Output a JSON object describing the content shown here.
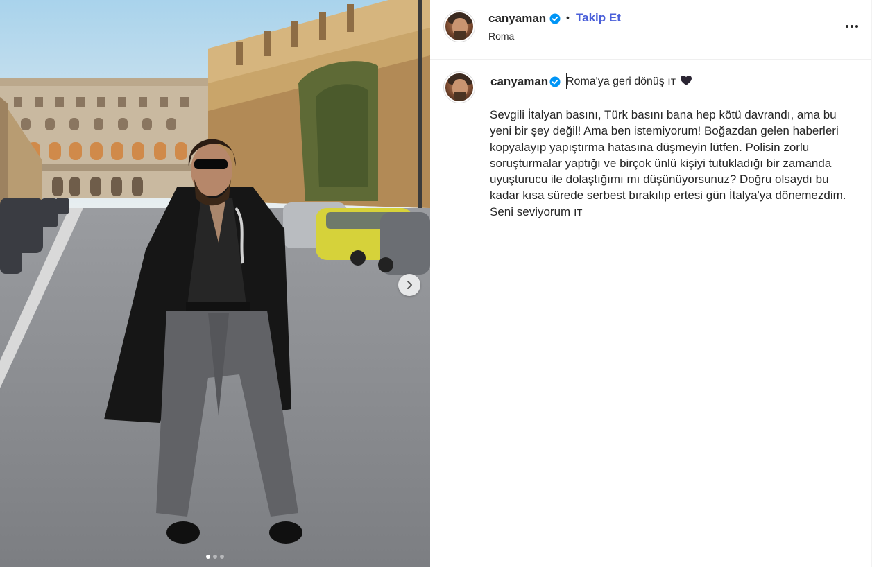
{
  "post": {
    "author": "canyaman",
    "location": "Roma",
    "follow_label": "Takip Et",
    "separator": "•",
    "caption_first_line": "Roma'ya geri dönüş",
    "caption_flag": "ıт",
    "caption_body": "Sevgili İtalyan basını, Türk basını bana hep kötü davrandı, ama bu yeni bir şey değil! Ama ben istemiyorum! Boğazdan gelen haberleri kopyalayıp yapıştırma hatasına düşmeyin lütfen. Polisin zorlu soruşturmalar yaptığı ve birçok ünlü kişiyi tutukladığı bir zamanda uyuşturucu ile dolaştığımı mı düşünüyorsunuz? Doğru olsaydı bu kadar kısa sürede serbest bırakılıp ertesi gün İtalya'ya dönemezdim. Seni seviyorum ıт"
  },
  "carousel": {
    "total_slides": 3,
    "active_slide": 1,
    "next_icon": "chevron-right-icon"
  },
  "icons": {
    "verified": "verified-badge-icon",
    "heart": "black-heart-icon",
    "more": "more-options-icon"
  },
  "colors": {
    "follow_link": "#4a5fd9",
    "verified_badge": "#0095f6",
    "text": "#262626"
  }
}
